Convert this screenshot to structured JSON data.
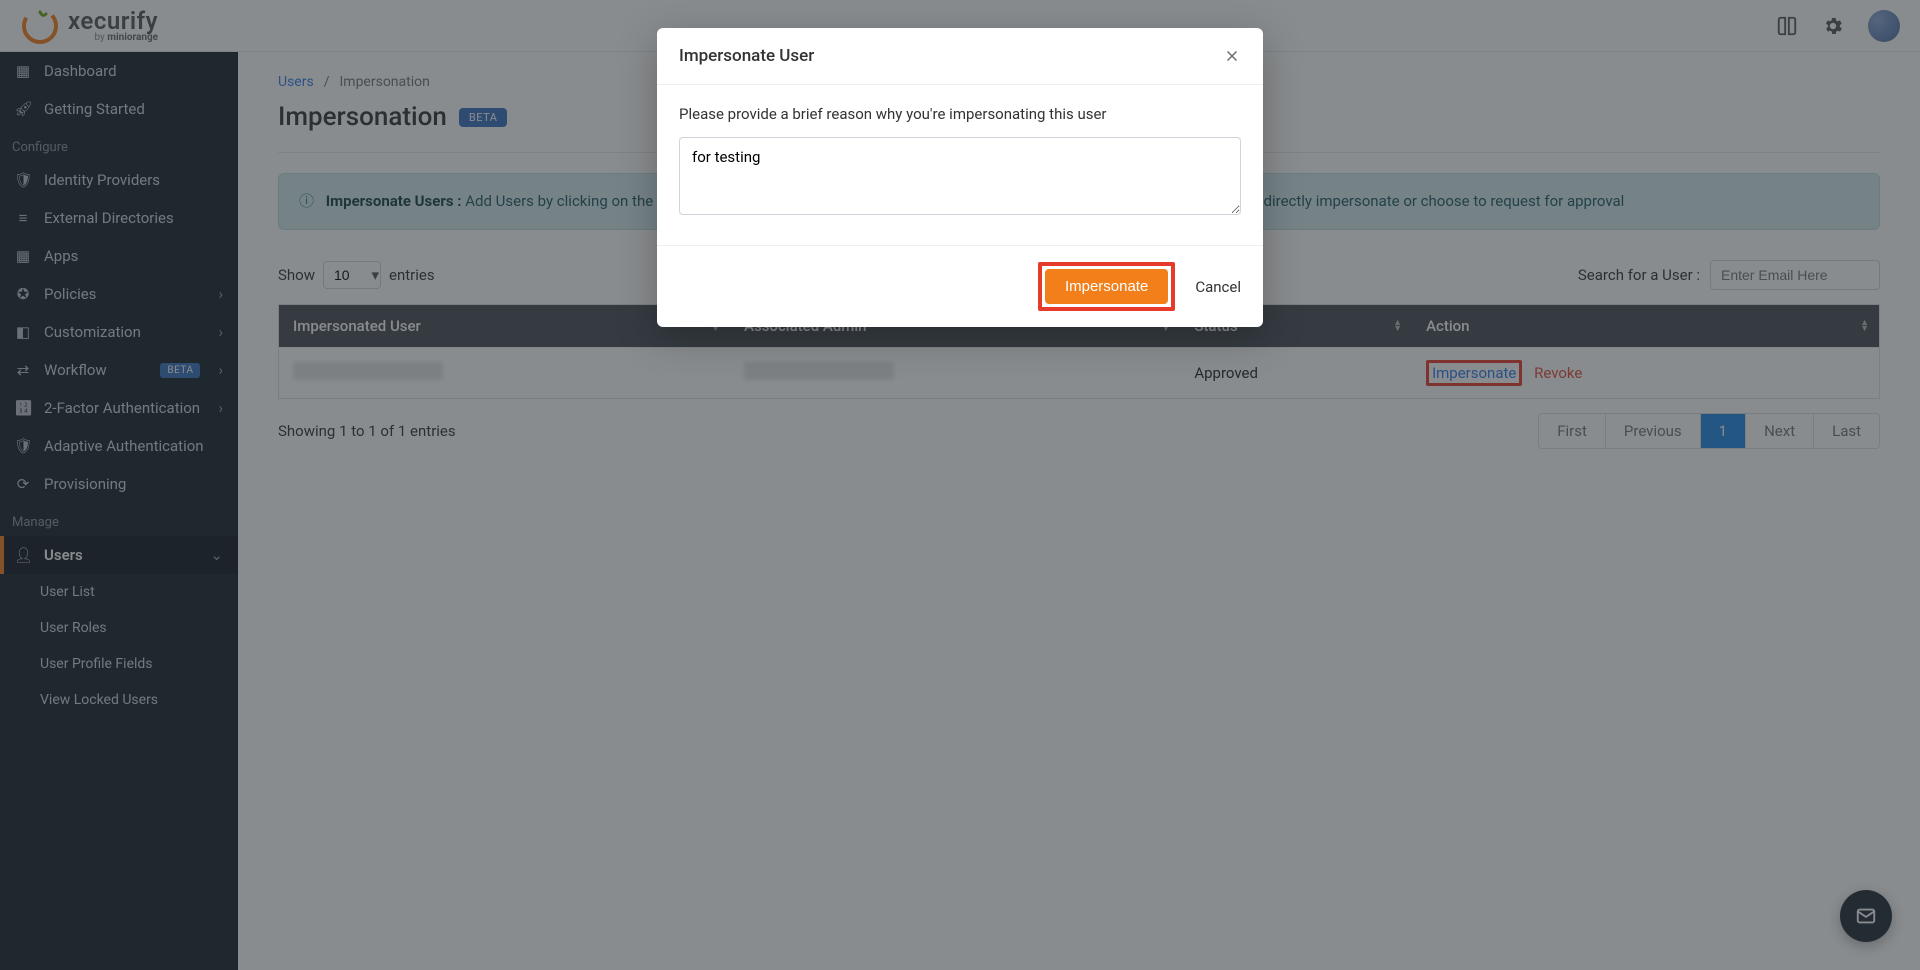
{
  "brand": {
    "name": "xecurify",
    "sub_prefix": "by ",
    "sub_brand": "miniorange"
  },
  "topbar": {
    "book_icon": "book-icon",
    "gear_icon": "gear-icon",
    "avatar": "user-avatar"
  },
  "sidebar": {
    "items": {
      "dashboard": "Dashboard",
      "getting_started": "Getting Started",
      "configure": "Configure",
      "idp": "Identity Providers",
      "ext_dir": "External Directories",
      "apps": "Apps",
      "policies": "Policies",
      "customization": "Customization",
      "workflow": "Workflow",
      "workflow_badge": "BETA",
      "two_fa": "2-Factor Authentication",
      "adaptive": "Adaptive Authentication",
      "provisioning": "Provisioning",
      "manage": "Manage",
      "users": "Users",
      "user_list": "User List",
      "user_roles": "User Roles",
      "user_profile": "User Profile Fields",
      "view_locked": "View Locked Users"
    }
  },
  "breadcrumb": {
    "root": "Users",
    "sep": "/",
    "current": "Impersonation"
  },
  "page": {
    "title": "Impersonation",
    "badge": "BETA"
  },
  "banner": {
    "label": "Impersonate Users : ",
    "text_a": "Add Users by clicking on the action dropdown in the users list and choose impersonate in the action dropdown. You can directly impersonate or choose to request for approval"
  },
  "table": {
    "show_label": "Show",
    "show_value": "10",
    "entries_label": "entries",
    "search_label": "Search for a User :",
    "search_placeholder": "Enter Email Here",
    "cols": {
      "user": "Impersonated User",
      "admin": "Associated Admin",
      "status": "Status",
      "action": "Action"
    },
    "row": {
      "status": "Approved",
      "impersonate": "Impersonate",
      "revoke": "Revoke"
    },
    "footer": "Showing 1 to 1 of 1 entries",
    "pager": {
      "first": "First",
      "prev": "Previous",
      "p1": "1",
      "next": "Next",
      "last": "Last"
    }
  },
  "modal": {
    "title": "Impersonate User",
    "prompt": "Please provide a brief reason why you're impersonating this user",
    "reason_value": "for testing",
    "impersonate": "Impersonate",
    "cancel": "Cancel"
  }
}
